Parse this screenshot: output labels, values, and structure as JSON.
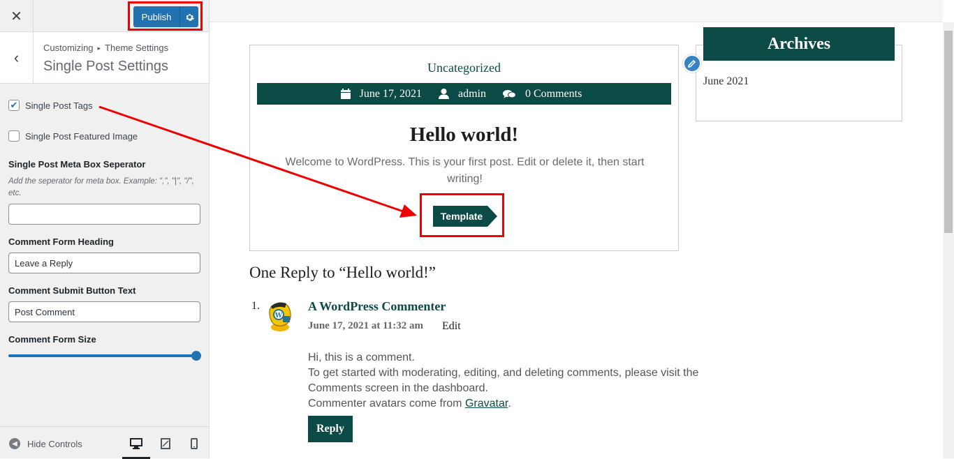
{
  "sidebar": {
    "publish_label": "Publish",
    "breadcrumb": {
      "root": "Customizing",
      "separator": "▸",
      "current": "Theme Settings"
    },
    "section_title": "Single Post Settings",
    "controls": {
      "tags": {
        "label": "Single Post Tags",
        "checked": true
      },
      "featured_image": {
        "label": "Single Post Featured Image",
        "checked": false
      },
      "meta_sep": {
        "label": "Single Post Meta Box Seperator",
        "description": "Add the seperator for meta box. Example: \",\", \"|\", \"/\", etc.",
        "value": ""
      },
      "comment_heading": {
        "label": "Comment Form Heading",
        "value": "Leave a Reply"
      },
      "comment_submit": {
        "label": "Comment Submit Button Text",
        "value": "Post Comment"
      },
      "comment_size": {
        "label": "Comment Form Size",
        "value": 1.0
      }
    },
    "footer": {
      "hide_controls": "Hide Controls",
      "devices": [
        "desktop-icon",
        "tablet-icon",
        "mobile-icon"
      ],
      "active_device": "desktop"
    }
  },
  "preview": {
    "post": {
      "category": "Uncategorized",
      "date": "June 17, 2021",
      "author": "admin",
      "comments": "0 Comments",
      "title": "Hello world!",
      "excerpt": "Welcome to WordPress. This is your first post. Edit or delete it, then start writing!",
      "template_button": "Template"
    },
    "archives": {
      "heading": "Archives",
      "items": [
        "June 2021"
      ]
    },
    "reply_heading": "One Reply to “Hello world!”",
    "comment": {
      "number": "1.",
      "author": "A WordPress Commenter",
      "date": "June 17, 2021 at 11:32 am",
      "edit": "Edit",
      "line1": "Hi, this is a comment.",
      "line2": "To get started with moderating, editing, and deleting comments, please visit the Comments screen in the dashboard.",
      "line3_prefix": "Commenter avatars come from ",
      "line3_link": "Gravatar",
      "line3_suffix": ".",
      "reply_button": "Reply"
    }
  },
  "colors": {
    "accent": "#0c4a45",
    "wp_blue": "#2271b1",
    "highlight": "#e00000"
  }
}
